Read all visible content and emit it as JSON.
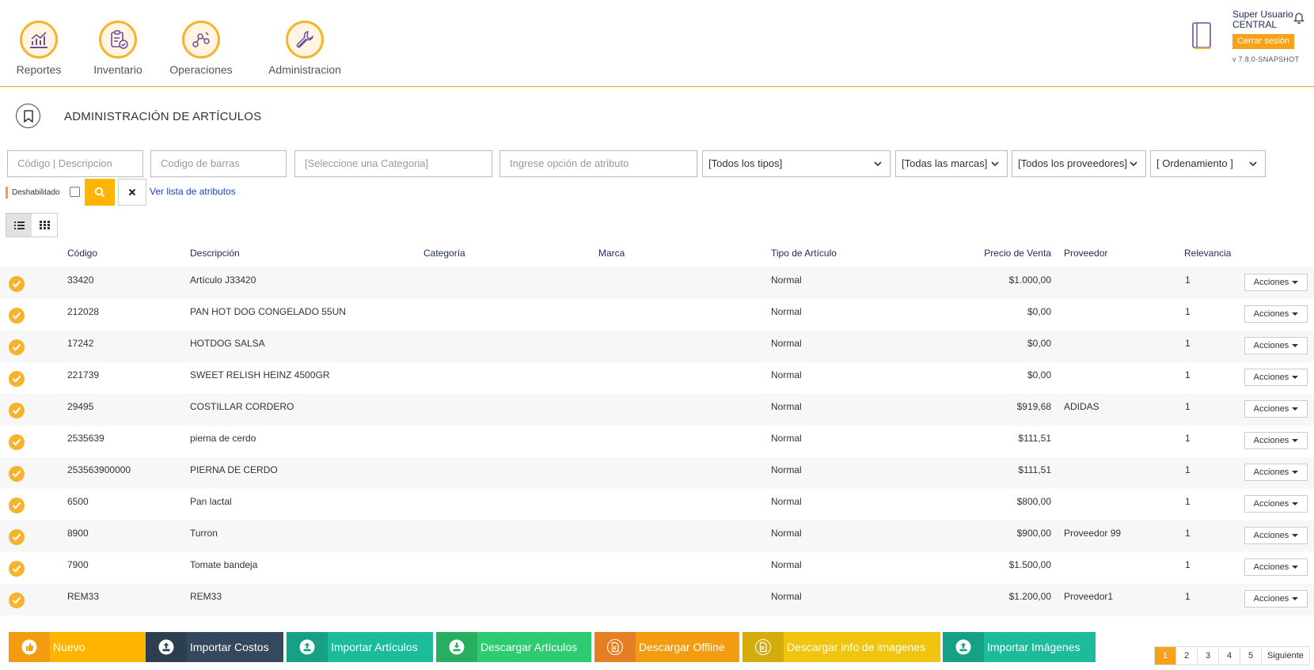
{
  "header": {
    "nav": [
      {
        "label": "Reportes",
        "icon": "chart-icon"
      },
      {
        "label": "Inventario",
        "icon": "clipboard-check-icon"
      },
      {
        "label": "Operaciones",
        "icon": "nodes-icon"
      },
      {
        "label": "Administracion",
        "icon": "wrench-icon"
      }
    ],
    "user": {
      "line1": "Super Usuario",
      "line2": "CENTRAL"
    },
    "logout_label": "Cerrar sesión",
    "version": "v 7.8.0-SNAPSHOT"
  },
  "page": {
    "title": "ADMINISTRACIÓN DE ARTÍCULOS"
  },
  "filters": {
    "code_placeholder": "Código | Descripcion",
    "barcode_placeholder": "Codigo de barras",
    "category_placeholder": "[Seleccione una Categoria]",
    "attribute_placeholder": "Ingrese opción de atributo",
    "type_selected": "[Todos los tipos]",
    "brand_selected": "[Todas las marcas]",
    "supplier_selected": "[Todos los proveedores]",
    "order_selected": "[ Ordenamiento ]",
    "disabled_label": "Deshabilitado",
    "attributes_link": "Ver lista de atributos"
  },
  "table": {
    "headers": {
      "code": "Código",
      "description": "Descripción",
      "category": "Categoría",
      "brand": "Marca",
      "type": "Tipo de Artículo",
      "price": "Precio de Venta",
      "supplier": "Proveedor",
      "relevance": "Relevancia"
    },
    "actions_label": "Acciones",
    "rows": [
      {
        "code": "33420",
        "description": "Artículo J33420",
        "category": "",
        "brand": "",
        "type": "Normal",
        "price": "$1.000,00",
        "supplier": "",
        "relevance": "1"
      },
      {
        "code": "212028",
        "description": "PAN HOT DOG CONGELADO 55UN",
        "category": "",
        "brand": "",
        "type": "Normal",
        "price": "$0,00",
        "supplier": "",
        "relevance": "1"
      },
      {
        "code": "17242",
        "description": "HOTDOG SALSA",
        "category": "",
        "brand": "",
        "type": "Normal",
        "price": "$0,00",
        "supplier": "",
        "relevance": "1"
      },
      {
        "code": "221739",
        "description": "SWEET RELISH HEINZ 4500GR",
        "category": "",
        "brand": "",
        "type": "Normal",
        "price": "$0,00",
        "supplier": "",
        "relevance": "1"
      },
      {
        "code": "29495",
        "description": "COSTILLAR CORDERO",
        "category": "",
        "brand": "",
        "type": "Normal",
        "price": "$919,68",
        "supplier": "ADIDAS",
        "relevance": "1"
      },
      {
        "code": "2535639",
        "description": "pierna de cerdo",
        "category": "",
        "brand": "",
        "type": "Normal",
        "price": "$111,51",
        "supplier": "",
        "relevance": "1"
      },
      {
        "code": "253563900000",
        "description": "PIERNA DE CERDO",
        "category": "",
        "brand": "",
        "type": "Normal",
        "price": "$111,51",
        "supplier": "",
        "relevance": "1"
      },
      {
        "code": "6500",
        "description": "Pan lactal",
        "category": "",
        "brand": "",
        "type": "Normal",
        "price": "$800,00",
        "supplier": "",
        "relevance": "1"
      },
      {
        "code": "8900",
        "description": "Turron",
        "category": "",
        "brand": "",
        "type": "Normal",
        "price": "$900,00",
        "supplier": "Proveedor 99",
        "relevance": "1"
      },
      {
        "code": "7900",
        "description": "Tomate bandeja",
        "category": "",
        "brand": "",
        "type": "Normal",
        "price": "$1.500,00",
        "supplier": "",
        "relevance": "1"
      },
      {
        "code": "REM33",
        "description": "REM33",
        "category": "",
        "brand": "",
        "type": "Normal",
        "price": "$1.200,00",
        "supplier": "Proveedor1",
        "relevance": "1"
      }
    ]
  },
  "bottom_buttons": [
    {
      "label": "Nuevo",
      "color": "#ffb400",
      "icon_bg": "#f39c12",
      "icon": "thumbs-up-icon"
    },
    {
      "label": "Importar Costos",
      "color": "#34495e",
      "icon_bg": "#2c3e50",
      "icon": "upload-icon"
    },
    {
      "label": "Importar Artículos",
      "color": "#1abc9c",
      "icon_bg": "#16a085",
      "icon": "upload-icon"
    },
    {
      "label": "Descargar Artículos",
      "color": "#2ecc71",
      "icon_bg": "#27ae60",
      "icon": "download-icon"
    },
    {
      "label": "Descargar Offline",
      "color": "#f39c12",
      "icon_bg": "#e67e22",
      "icon": "excel-file-icon"
    },
    {
      "label": "Descargar info de imagenes",
      "color": "#f1c40f",
      "icon_bg": "#d4ac0d",
      "icon": "excel-file-icon"
    },
    {
      "label": "Importar Imágenes",
      "color": "#1abc9c",
      "icon_bg": "#16a085",
      "icon": "upload-icon"
    }
  ],
  "pagination": {
    "pages": [
      "1",
      "2",
      "3",
      "4",
      "5"
    ],
    "current": "1",
    "next_label": "Siguiente"
  },
  "colors": {
    "accent": "#f7a21b",
    "header_text": "#1d2a5c",
    "link": "#1f3fd1"
  }
}
